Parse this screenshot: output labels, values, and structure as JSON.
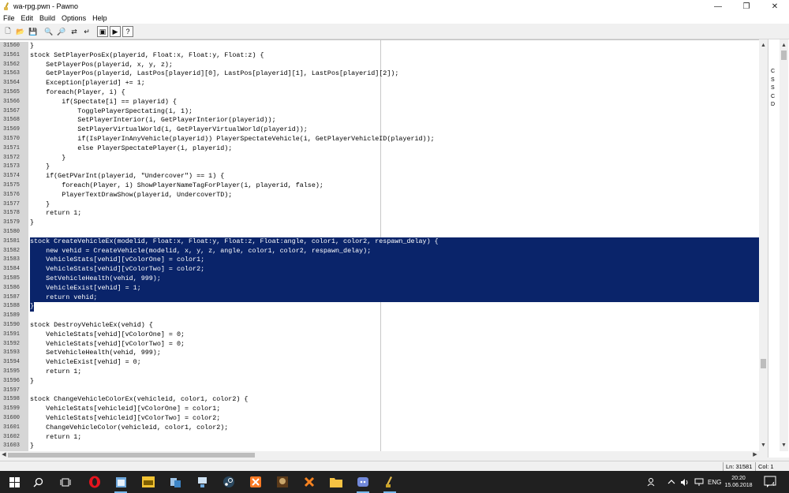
{
  "window": {
    "title": "wa-rpg.pwn - Pawno"
  },
  "menu": [
    "File",
    "Edit",
    "Build",
    "Options",
    "Help"
  ],
  "toolbar": [
    {
      "name": "new-file-icon",
      "glyph": "🗋"
    },
    {
      "name": "open-file-icon",
      "glyph": "📂"
    },
    {
      "name": "save-file-icon",
      "glyph": "💾"
    },
    {
      "name": "find-icon",
      "glyph": "🔍"
    },
    {
      "name": "find-next-icon",
      "glyph": "🔎"
    },
    {
      "name": "replace-icon",
      "glyph": "⇄"
    },
    {
      "name": "goto-line-icon",
      "glyph": "↵"
    },
    {
      "name": "compile-icon",
      "glyph": "▣"
    },
    {
      "name": "run-icon",
      "glyph": "▶"
    },
    {
      "name": "help-icon",
      "glyph": "?"
    }
  ],
  "code": [
    {
      "ln": "31560",
      "text": "}"
    },
    {
      "ln": "31561",
      "text": "stock SetPlayerPosEx(playerid, Float:x, Float:y, Float:z) {"
    },
    {
      "ln": "31562",
      "text": "    SetPlayerPos(playerid, x, y, z);"
    },
    {
      "ln": "31563",
      "text": "    GetPlayerPos(playerid, LastPos[playerid][0], LastPos[playerid][1], LastPos[playerid][2]);"
    },
    {
      "ln": "31564",
      "text": "    Exception[playerid] += 1;"
    },
    {
      "ln": "31565",
      "text": "    foreach(Player, i) {"
    },
    {
      "ln": "31566",
      "text": "        if(Spectate[i] == playerid) {"
    },
    {
      "ln": "31567",
      "text": "            TogglePlayerSpectating(i, 1);"
    },
    {
      "ln": "31568",
      "text": "            SetPlayerInterior(i, GetPlayerInterior(playerid));"
    },
    {
      "ln": "31569",
      "text": "            SetPlayerVirtualWorld(i, GetPlayerVirtualWorld(playerid));"
    },
    {
      "ln": "31570",
      "text": "            if(IsPlayerInAnyVehicle(playerid)) PlayerSpectateVehicle(i, GetPlayerVehicleID(playerid));"
    },
    {
      "ln": "31571",
      "text": "            else PlayerSpectatePlayer(i, playerid);"
    },
    {
      "ln": "31572",
      "text": "        }"
    },
    {
      "ln": "31573",
      "text": "    }"
    },
    {
      "ln": "31574",
      "text": "    if(GetPVarInt(playerid, \"Undercover\") == 1) {"
    },
    {
      "ln": "31575",
      "text": "        foreach(Player, i) ShowPlayerNameTagForPlayer(i, playerid, false);"
    },
    {
      "ln": "31576",
      "text": "        PlayerTextDrawShow(playerid, UndercoverTD);"
    },
    {
      "ln": "31577",
      "text": "    }"
    },
    {
      "ln": "31578",
      "text": "    return 1;"
    },
    {
      "ln": "31579",
      "text": "}"
    },
    {
      "ln": "31580",
      "text": ""
    },
    {
      "ln": "31581",
      "text": "stock CreateVehicleEx(modelid, Float:x, Float:y, Float:z, Float:angle, color1, color2, respawn_delay) {",
      "selected": true
    },
    {
      "ln": "31582",
      "text": "    new vehid = CreateVehicle(modelid, x, y, z, angle, color1, color2, respawn_delay);",
      "selected": true
    },
    {
      "ln": "31583",
      "text": "    VehicleStats[vehid][vColorOne] = color1;",
      "selected": true
    },
    {
      "ln": "31584",
      "text": "    VehicleStats[vehid][vColorTwo] = color2;",
      "selected": true
    },
    {
      "ln": "31585",
      "text": "    SetVehicleHealth(vehid, 999);",
      "selected": true
    },
    {
      "ln": "31586",
      "text": "    VehicleExist[vehid] = 1;",
      "selected": true
    },
    {
      "ln": "31587",
      "text": "    return vehid;",
      "selected": true
    },
    {
      "ln": "31588",
      "text": "}",
      "selected": true,
      "last": true
    },
    {
      "ln": "31589",
      "text": ""
    },
    {
      "ln": "31590",
      "text": "stock DestroyVehicleEx(vehid) {"
    },
    {
      "ln": "31591",
      "text": "    VehicleStats[vehid][vColorOne] = 0;"
    },
    {
      "ln": "31592",
      "text": "    VehicleStats[vehid][vColorTwo] = 0;"
    },
    {
      "ln": "31593",
      "text": "    SetVehicleHealth(vehid, 999);"
    },
    {
      "ln": "31594",
      "text": "    VehicleExist[vehid] = 0;"
    },
    {
      "ln": "31595",
      "text": "    return 1;"
    },
    {
      "ln": "31596",
      "text": "}"
    },
    {
      "ln": "31597",
      "text": ""
    },
    {
      "ln": "31598",
      "text": "stock ChangeVehicleColorEx(vehicleid, color1, color2) {"
    },
    {
      "ln": "31599",
      "text": "    VehicleStats[vehicleid][vColorOne] = color1;"
    },
    {
      "ln": "31600",
      "text": "    VehicleStats[vehicleid][vColorTwo] = color2;"
    },
    {
      "ln": "31601",
      "text": "    ChangeVehicleColor(vehicleid, color1, color2);"
    },
    {
      "ln": "31602",
      "text": "    return 1;"
    },
    {
      "ln": "31603",
      "text": "}"
    }
  ],
  "side_panel": [
    "C",
    "S",
    "S",
    "C",
    "D"
  ],
  "status": {
    "line": "Ln: 31581",
    "col": "Col: 1"
  },
  "colors": {
    "selection": "#0a246a",
    "gutter": "#d6d6d6",
    "taskbar": "#202020"
  },
  "taskbar": {
    "icons": [
      "windows-start-icon",
      "search-icon",
      "task-view-icon",
      "opera-icon",
      "notepad-icon",
      "editor-icon",
      "files-icon",
      "network-icon",
      "steam-icon",
      "xampp-icon",
      "game-icon",
      "xampp-control-icon",
      "folder-icon",
      "discord-icon",
      "pawno-icon"
    ],
    "lang": "ENG",
    "time": "20:20",
    "date": "15.06.2018",
    "notifications": "4"
  }
}
